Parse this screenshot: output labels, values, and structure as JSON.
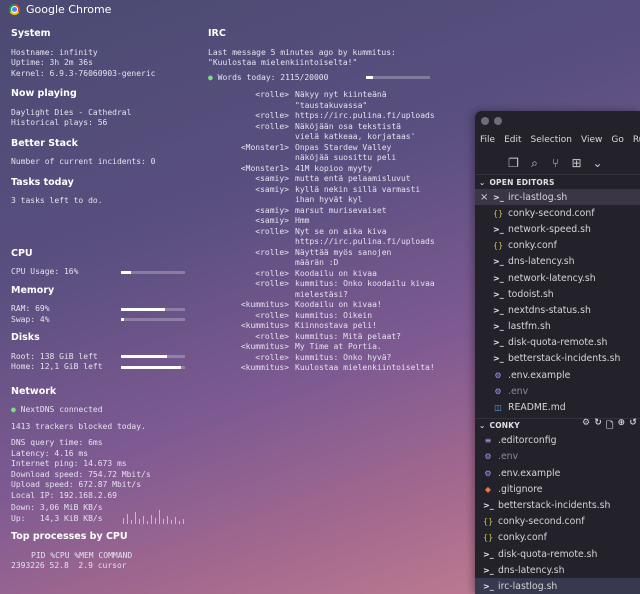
{
  "topbar": {
    "app_title": "Google Chrome"
  },
  "system": {
    "heading": "System",
    "hostname": "Hostname: infinity",
    "uptime": "Uptime: 3h 2m 36s",
    "kernel": "Kernel: 6.9.3-76060903-generic"
  },
  "now_playing": {
    "heading": "Now playing",
    "track": "Daylight Dies - Cathedral",
    "plays": "Historical plays: 56"
  },
  "better_stack": {
    "heading": "Better Stack",
    "incidents": "Number of current incidents: 0"
  },
  "tasks": {
    "heading": "Tasks today",
    "summary": "3 tasks left to do."
  },
  "cpu": {
    "heading": "CPU",
    "usage_label": "CPU Usage: 16%",
    "usage_fraction": 0.16
  },
  "memory": {
    "heading": "Memory",
    "ram_label": "RAM: 69%",
    "ram_fraction": 0.69,
    "swap_label": "Swap: 4%",
    "swap_fraction": 0.04
  },
  "disks": {
    "heading": "Disks",
    "root_label": "Root: 138 GiB left",
    "root_fraction": 0.72,
    "home_label": "Home: 12,1 GiB left",
    "home_fraction": 0.94
  },
  "network": {
    "heading": "Network",
    "nextdns": "NextDNS connected",
    "trackers": "1413 trackers blocked today.",
    "dns_query": "DNS query time: 6ms",
    "latency": "Latency: 4.16 ms",
    "ping": "Internet ping: 14.673 ms",
    "download": "Download speed: 754.72 Mbit/s",
    "upload": "Upload speed: 672.87 Mbit/s",
    "local_ip": "Local IP: 192.168.2.69",
    "down": "Down: 3,06 MiB KB/s",
    "up": "Up:   14,3 KiB KB/s"
  },
  "processes": {
    "heading": "Top processes by CPU",
    "header_row": "PID %CPU %MEM COMMAND",
    "rows": [
      "2393226 52.8  2.9 cursor"
    ]
  },
  "irc": {
    "heading": "IRC",
    "last_message": "Last message 5 minutes ago by kummitus:",
    "last_quote": "\"Kuulostaa mielenkiintoiselta!\"",
    "words_today": "Words today: 2115/20000",
    "words_fraction": 0.106,
    "messages": [
      {
        "nick": "<rolle>",
        "text": "Näkyy nyt kiinteänä"
      },
      {
        "nick": "",
        "text": "\"taustakuvassa\""
      },
      {
        "nick": "<rolle>",
        "text": "https://irc.pulina.fi/uploads"
      },
      {
        "nick": "<rolle>",
        "text": "Näköjään osa tekstistä"
      },
      {
        "nick": "",
        "text": "vielä katkeaa, korjataas'"
      },
      {
        "nick": "<Monster1>",
        "text": "Onpas Stardew Valley"
      },
      {
        "nick": "",
        "text": "näköjää suosittu peli"
      },
      {
        "nick": "<Monster1>",
        "text": "41M kopioo myyty"
      },
      {
        "nick": "<samiy>",
        "text": "mutta entä pelaamisluvut"
      },
      {
        "nick": "<samiy>",
        "text": "kyllä nekin sillä varmasti"
      },
      {
        "nick": "",
        "text": "ihan hyvät kyl"
      },
      {
        "nick": "<samiy>",
        "text": "marsut murisevaiset"
      },
      {
        "nick": "<samiy>",
        "text": "Hmm"
      },
      {
        "nick": "<rolle>",
        "text": "Nyt se on aika kiva"
      },
      {
        "nick": "",
        "text": "https://irc.pulina.fi/uploads"
      },
      {
        "nick": "<rolle>",
        "text": "Näyttää myös sanojen"
      },
      {
        "nick": "",
        "text": "määrän :D"
      },
      {
        "nick": "<rolle>",
        "text": "Koodailu on kivaa"
      },
      {
        "nick": "<rolle>",
        "text": "kummitus: Onko koodailu kivaa"
      },
      {
        "nick": "",
        "text": "mielestäsi?"
      },
      {
        "nick": "<kummitus>",
        "text": "Koodailu on kivaa!"
      },
      {
        "nick": "<rolle>",
        "text": "kummitus: Oikein"
      },
      {
        "nick": "<kummitus>",
        "text": "Kiinnostava peli!"
      },
      {
        "nick": "<rolle>",
        "text": "kummitus: Mitä pelaat?"
      },
      {
        "nick": "<kummitus>",
        "text": "My Time at Portia."
      },
      {
        "nick": "<rolle>",
        "text": "kummitus: Onko hyvä?"
      },
      {
        "nick": "<kummitus>",
        "text": "Kuulostaa mielenkiintoiselta!"
      }
    ]
  },
  "editor": {
    "menu": [
      "File",
      "Edit",
      "Selection",
      "View",
      "Go",
      "Run"
    ],
    "open_editors_heading": "OPEN EDITORS",
    "open_editors": [
      {
        "icon": "sh",
        "name": "irc-lastlog.sh",
        "active": true
      },
      {
        "icon": "json",
        "name": "conky-second.conf"
      },
      {
        "icon": "sh",
        "name": "network-speed.sh"
      },
      {
        "icon": "json",
        "name": "conky.conf"
      },
      {
        "icon": "sh",
        "name": "dns-latency.sh"
      },
      {
        "icon": "sh",
        "name": "network-latency.sh"
      },
      {
        "icon": "sh",
        "name": "todoist.sh"
      },
      {
        "icon": "sh",
        "name": "nextdns-status.sh"
      },
      {
        "icon": "sh",
        "name": "lastfm.sh"
      },
      {
        "icon": "sh",
        "name": "disk-quota-remote.sh"
      },
      {
        "icon": "sh",
        "name": "betterstack-incidents.sh"
      },
      {
        "icon": "gear",
        "name": ".env.example"
      },
      {
        "icon": "gear",
        "name": ".env",
        "dim": true
      },
      {
        "icon": "md",
        "name": "README.md"
      }
    ],
    "conky_heading": "CONKY",
    "conky_files": [
      {
        "icon": "eq",
        "name": ".editorconfig"
      },
      {
        "icon": "gear",
        "name": ".env",
        "dim": true
      },
      {
        "icon": "gear",
        "name": ".env.example"
      },
      {
        "icon": "git",
        "name": ".gitignore"
      },
      {
        "icon": "sh",
        "name": "betterstack-incidents.sh"
      },
      {
        "icon": "json",
        "name": "conky-second.conf"
      },
      {
        "icon": "json",
        "name": "conky.conf"
      },
      {
        "icon": "sh",
        "name": "disk-quota-remote.sh"
      },
      {
        "icon": "sh",
        "name": "dns-latency.sh"
      },
      {
        "icon": "sh",
        "name": "irc-lastlog.sh",
        "selected": true
      }
    ]
  }
}
